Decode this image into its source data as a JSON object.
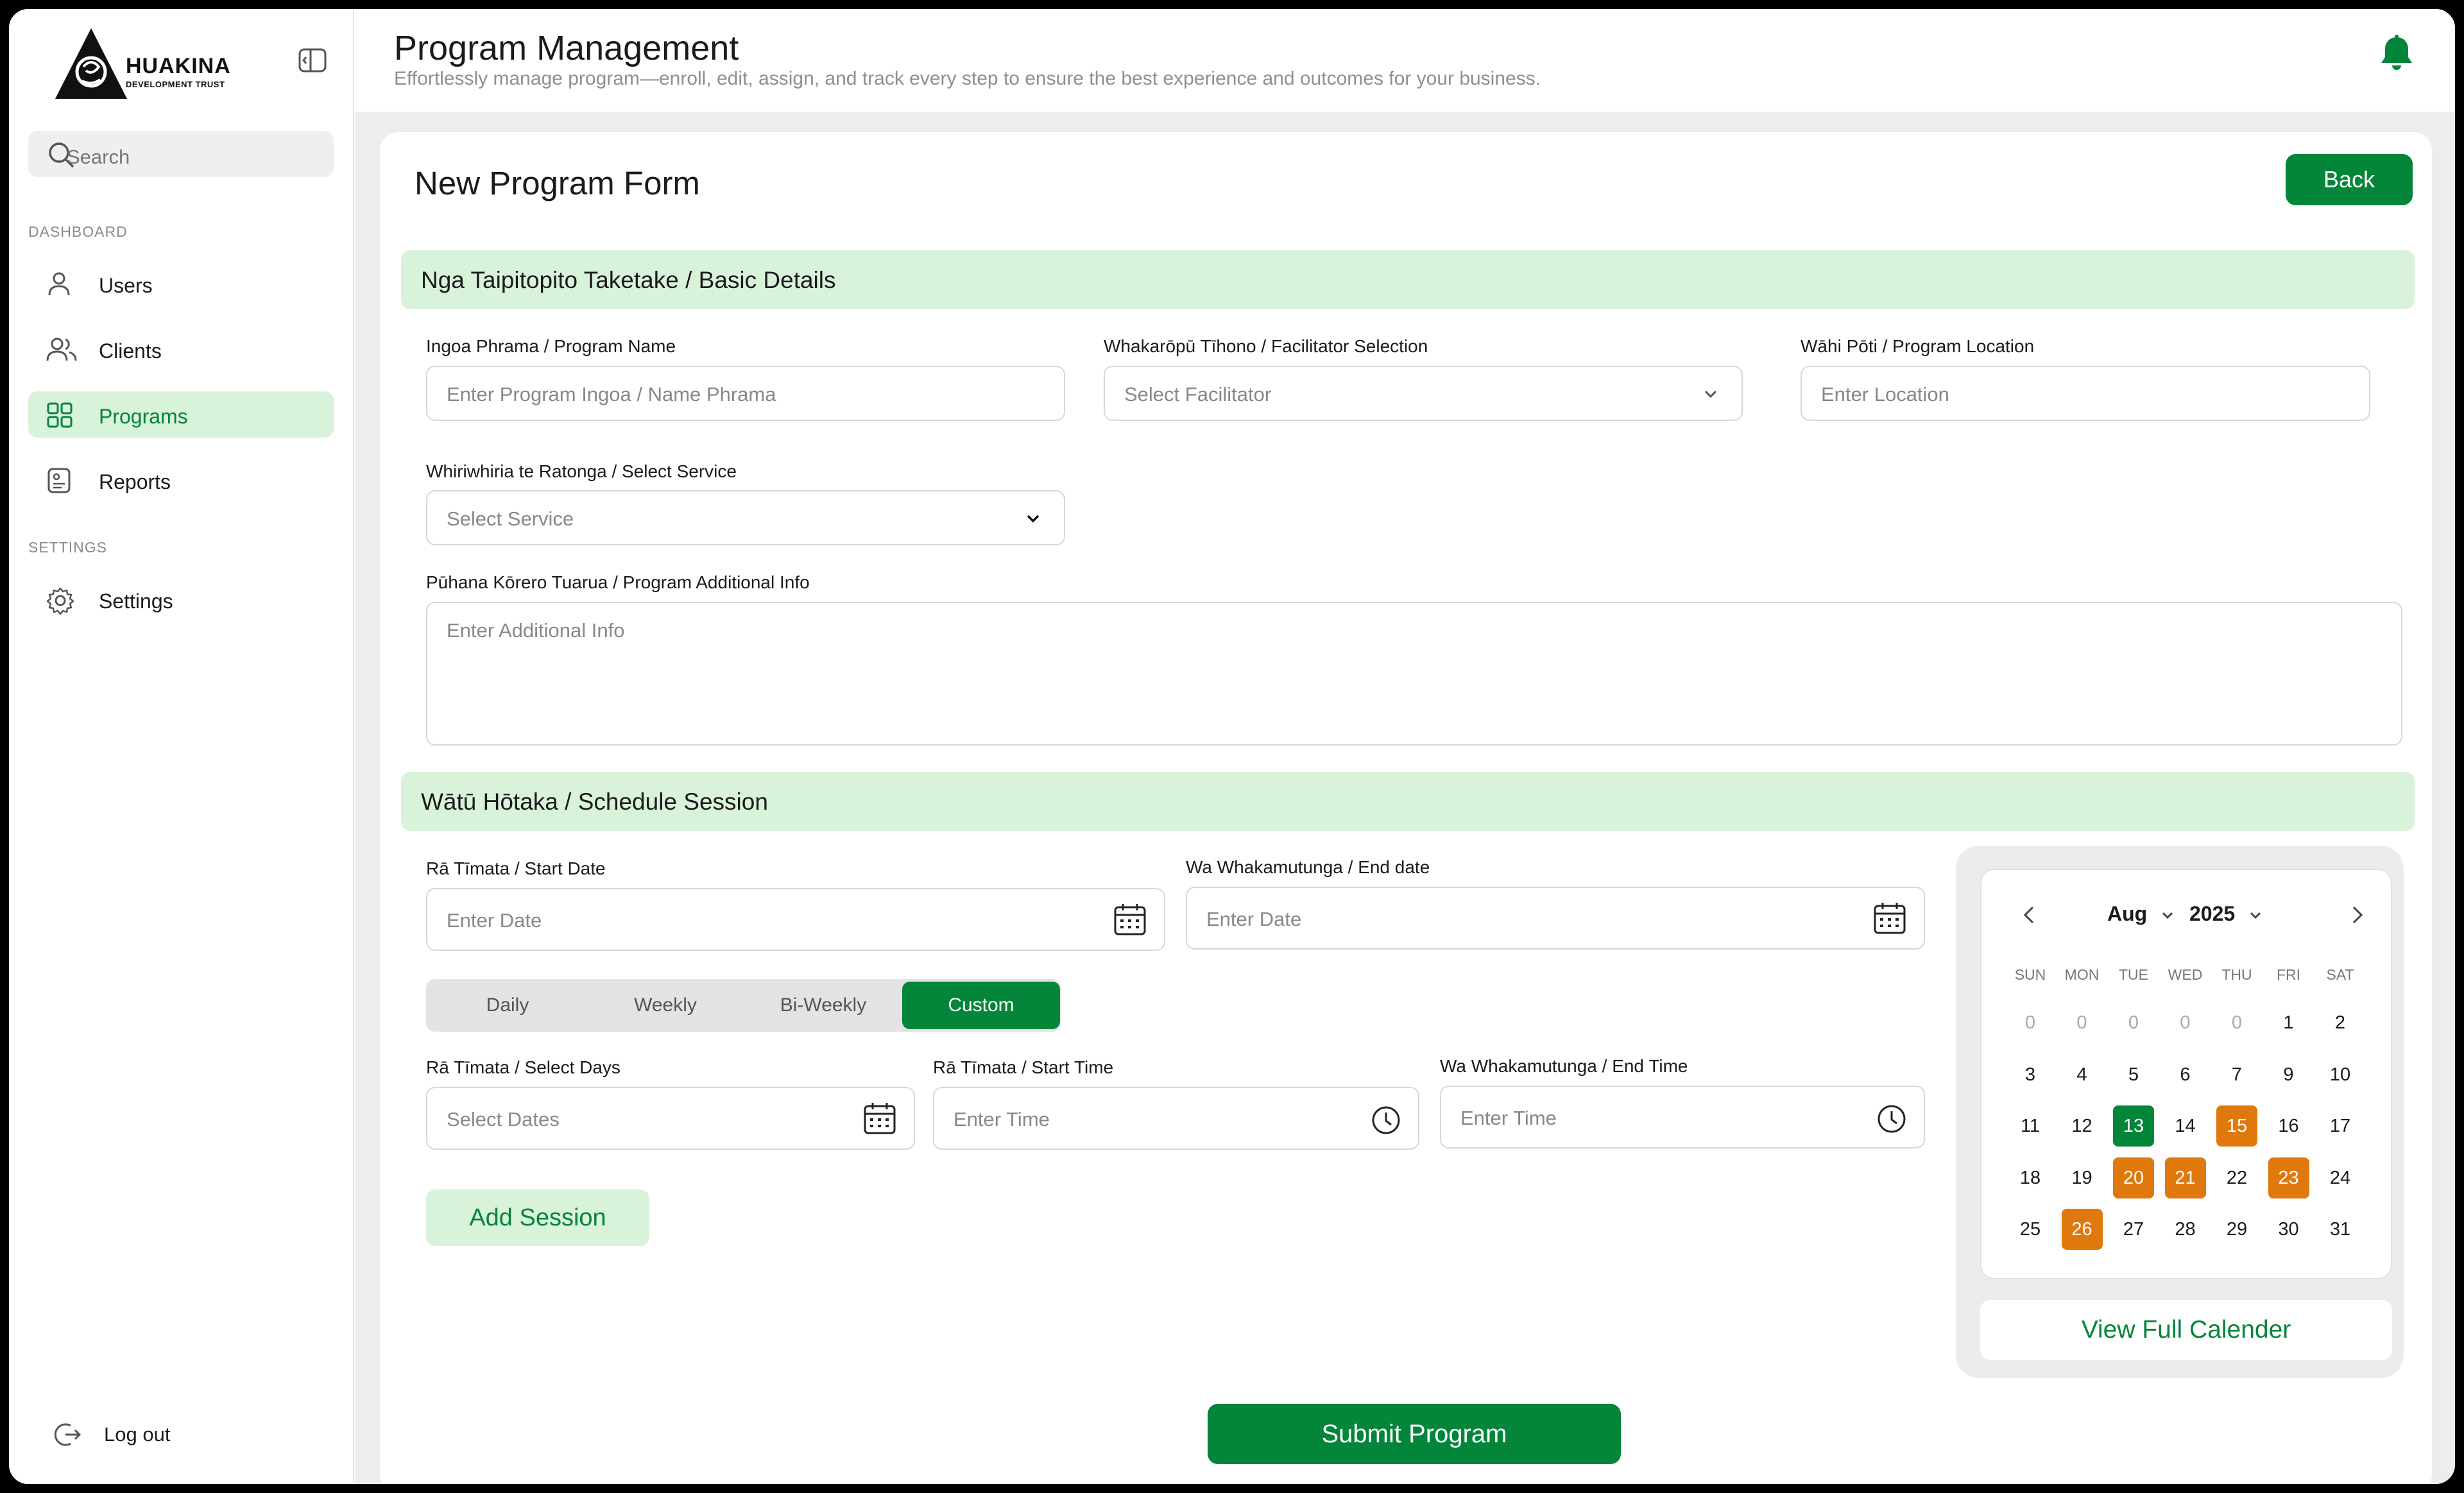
{
  "brand": {
    "name": "HUAKINA",
    "tagline": "DEVELOPMENT TRUST"
  },
  "sidebar": {
    "search_placeholder": "Search",
    "section_dashboard": "DASHBOARD",
    "section_settings": "SETTINGS",
    "items": [
      {
        "label": "Users",
        "icon": "user-icon"
      },
      {
        "label": "Clients",
        "icon": "users-icon"
      },
      {
        "label": "Programs",
        "icon": "grid-icon",
        "active": true
      },
      {
        "label": "Reports",
        "icon": "report-icon"
      },
      {
        "label": "Settings",
        "icon": "gear-icon"
      }
    ],
    "logout": "Log out"
  },
  "header": {
    "title": "Program Management",
    "subtitle": "Effortlessly manage program—enroll, edit, assign, and track every step to ensure the best experience and outcomes for your business."
  },
  "form": {
    "title": "New Program Form",
    "back": "Back",
    "basic_section": "Nga Taipitopito Taketake / Basic Details",
    "program_name_label": "Ingoa Phrama / Program Name",
    "program_name_placeholder": "Enter Program Ingoa / Name Phrama",
    "facilitator_label": "Whakarōpū Tīhono / Facilitator Selection",
    "facilitator_placeholder": "Select Facilitator",
    "location_label": "Wāhi Pōti / Program Location",
    "location_placeholder": "Enter Location",
    "service_label": "Whiriwhiria te Ratonga / Select Service",
    "service_placeholder": "Select Service",
    "info_label": "Pūhana Kōrero Tuarua / Program Additional Info",
    "info_placeholder": "Enter Additional Info",
    "schedule_section": "Wātū Hōtaka / Schedule Session",
    "start_date_label": "Rā Tīmata / Start Date",
    "start_date_placeholder": "Enter Date",
    "end_date_label": "Wa Whakamutunga / End date",
    "end_date_placeholder": "Enter Date",
    "frequency": [
      "Daily",
      "Weekly",
      "Bi-Weekly",
      "Custom"
    ],
    "frequency_selected": "Custom",
    "select_days_label": "Rā Tīmata / Select Days",
    "select_days_placeholder": "Select Dates",
    "start_time_label": "Rā Tīmata / Start Time",
    "start_time_placeholder": "Enter Time",
    "end_time_label": "Wa Whakamutunga / End Time",
    "end_time_placeholder": "Enter Time",
    "add_session": "Add Session",
    "submit": "Submit Program"
  },
  "calendar": {
    "month": "Aug",
    "year": "2025",
    "weekdays": [
      "SUN",
      "MON",
      "TUE",
      "WED",
      "THU",
      "FRI",
      "SAT"
    ],
    "weeks": [
      [
        "0",
        "0",
        "0",
        "0",
        "0",
        "1",
        "2"
      ],
      [
        "3",
        "4",
        "5",
        "6",
        "7",
        "9",
        "10"
      ],
      [
        "11",
        "12",
        "13",
        "14",
        "15",
        "16",
        "17"
      ],
      [
        "18",
        "19",
        "20",
        "21",
        "22",
        "23",
        "24"
      ],
      [
        "25",
        "26",
        "27",
        "28",
        "29",
        "30",
        "31"
      ]
    ],
    "today": "13",
    "highlighted": [
      "15",
      "20",
      "21",
      "23",
      "26"
    ],
    "view_full": "View Full Calender",
    "colors": {
      "today": "#03853a",
      "highlight": "#e0790d"
    }
  },
  "colors": {
    "primary": "#03853a",
    "light": "#d9f2da"
  }
}
